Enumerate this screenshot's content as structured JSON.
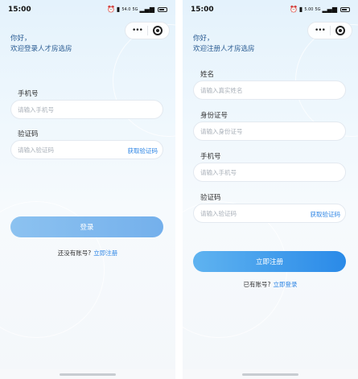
{
  "status_bar": {
    "time": "15:00",
    "icons": [
      "alarm-icon",
      "vibrate-icon",
      "network-speed-icon",
      "signal-icon",
      "battery-icon"
    ],
    "speed_left": "54.0",
    "speed_right": "5.00",
    "network": "5G"
  },
  "login_screen": {
    "greeting_line1": "你好，",
    "greeting_line2": "欢迎登录人才房选房",
    "phone_label": "手机号",
    "phone_placeholder": "请输入手机号",
    "code_label": "验证码",
    "code_placeholder": "请输入验证码",
    "get_code": "获取验证码",
    "submit": "登录",
    "switch_prompt": "还没有账号?",
    "switch_link": "立即注册"
  },
  "register_screen": {
    "greeting_line1": "你好，",
    "greeting_line2": "欢迎注册人才房选房",
    "name_label": "姓名",
    "name_placeholder": "请输入真实姓名",
    "id_label": "身份证号",
    "id_placeholder": "请输入身份证号",
    "phone_label": "手机号",
    "phone_placeholder": "请输入手机号",
    "code_label": "验证码",
    "code_placeholder": "请输入验证码",
    "get_code": "获取验证码",
    "submit": "立即注册",
    "switch_prompt": "已有账号?",
    "switch_link": "立即登录"
  },
  "colors": {
    "accent": "#2f86e5",
    "login_button": "#80b8ee",
    "register_button": "#3d9aec",
    "greeting_text": "#2b5d93"
  }
}
